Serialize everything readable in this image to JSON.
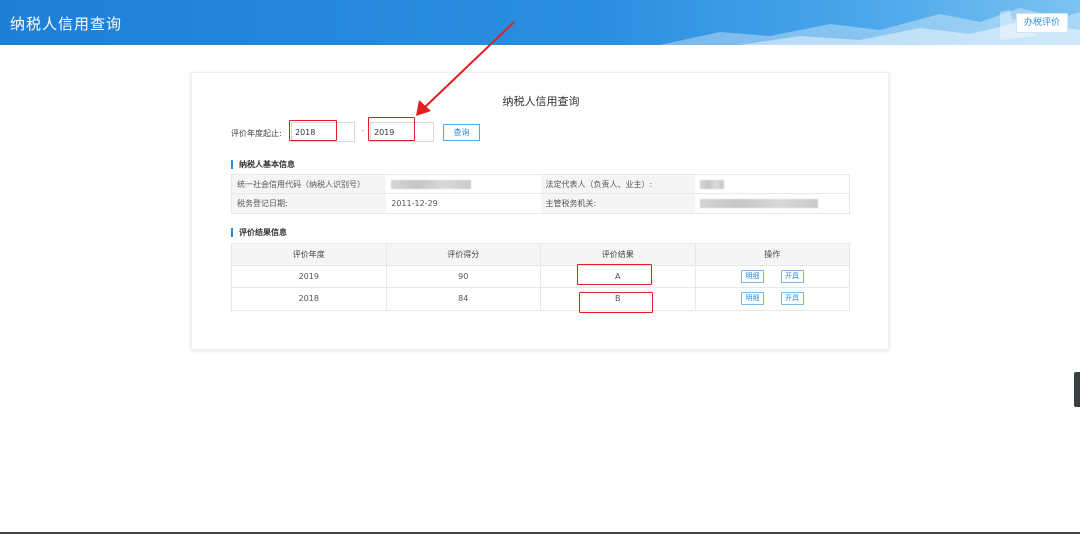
{
  "header": {
    "title": "纳税人信用查询",
    "eval_button": "办税评价"
  },
  "card": {
    "title": "纳税人信用查询",
    "filter": {
      "label": "评价年度起止:",
      "from_value": "2018",
      "separator": "-",
      "to_value": "2019",
      "query_button": "查询"
    },
    "basic_info": {
      "section_title": "纳税人基本信息",
      "rows": [
        {
          "label1": "统一社会信用代码（纳税人识别号）",
          "value1": "",
          "label2": "法定代表人（负责人、业主）:",
          "value2": ""
        },
        {
          "label1": "税务登记日期:",
          "value1": "2011-12-29",
          "label2": "主管税务机关:",
          "value2": ""
        }
      ]
    },
    "results": {
      "section_title": "评价结果信息",
      "headers": [
        "评价年度",
        "评价得分",
        "评价结果",
        "操作"
      ],
      "rows": [
        {
          "year": "2019",
          "score": "90",
          "grade": "A",
          "detail_btn": "明细",
          "cert_btn": "开具"
        },
        {
          "year": "2018",
          "score": "84",
          "grade": "B",
          "detail_btn": "明细",
          "cert_btn": "开具"
        }
      ]
    }
  },
  "colors": {
    "header_blue": "#1d7fd6",
    "accent": "#2a8ee0",
    "annotation_red": "#e02020"
  }
}
